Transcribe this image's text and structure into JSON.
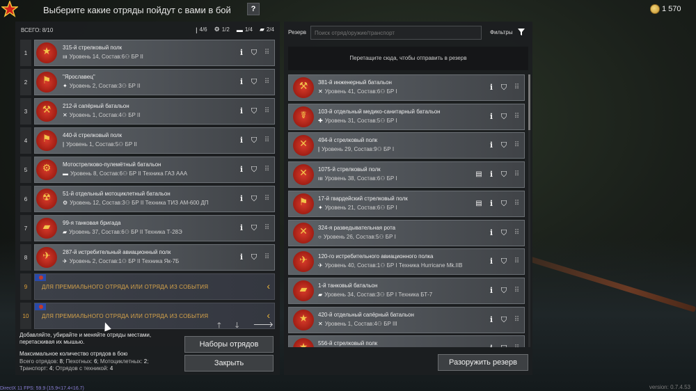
{
  "header": {
    "title": "Выберите какие отряды пойдут с вами в бой",
    "help": "?",
    "gold": "1 570"
  },
  "left": {
    "summary": "ВСЕГО: 8/10",
    "counts": [
      {
        "icon": "infantry-icon",
        "sym": "|",
        "value": "4/6"
      },
      {
        "icon": "motorcycle-icon",
        "sym": "⚙",
        "value": "1/2"
      },
      {
        "icon": "vehicle-icon",
        "sym": "▬",
        "value": "1/4"
      },
      {
        "icon": "tank-icon",
        "sym": "▰",
        "value": "2/4"
      }
    ],
    "squads": [
      {
        "num": "1",
        "name": "315-й стрелковый полк",
        "type": "ııı",
        "info": "Уровень 14, Состав:6⚇ БР II",
        "emblem": "★"
      },
      {
        "num": "2",
        "name": "\"Ярославец\"",
        "type": "✦",
        "info": "Уровень 2, Состав:3⚇ БР II",
        "emblem": "⚑"
      },
      {
        "num": "3",
        "name": "212-й сапёрный батальон",
        "type": "✕",
        "info": "Уровень 1, Состав:4⚇ БР II",
        "emblem": "⚒"
      },
      {
        "num": "4",
        "name": "440-й стрелковый полк",
        "type": "|",
        "info": "Уровень 1, Состав:5⚇ БР II",
        "emblem": "⚑"
      },
      {
        "num": "5",
        "name": "Мотострелково-пулемётный батальон",
        "type": "▬",
        "info": "Уровень 8, Состав:6⚇ БР II  Техника ГАЗ ААА",
        "emblem": "⚙"
      },
      {
        "num": "6",
        "name": "51-й отдельный мотоциклетный батальон",
        "type": "⚙",
        "info": "Уровень 12, Состав:3⚇ БР II  Техника ТИЗ АМ-600 ДП",
        "emblem": "☢"
      },
      {
        "num": "7",
        "name": "99-я танковая бригада",
        "type": "▰",
        "info": "Уровень 37, Состав:6⚇ БР II  Техника Т-28Э",
        "emblem": "▰"
      },
      {
        "num": "8",
        "name": "287-й истребительный авиационный полк",
        "type": "✈",
        "info": "Уровень 2, Состав:1⚇ БР II  Техника Як-7Б",
        "emblem": "✈"
      }
    ],
    "premium": [
      {
        "num": "9",
        "text": "ДЛЯ ПРЕМИАЛЬНОГО ОТРЯДА ИЛИ ОТРЯДА ИЗ СОБЫТИЯ"
      },
      {
        "num": "10",
        "text": "ДЛЯ ПРЕМИАЛЬНОГО ОТРЯДА ИЛИ ОТРЯДА ИЗ СОБЫТИЯ"
      }
    ],
    "hint": "Добавляйте, убирайте и меняйте отряды местами, перетаскивая их мышью.",
    "max_label": "Максимальное количество отрядов в бою",
    "max_line1_a": "Всего отрядов: ",
    "max_total": "8",
    "max_line1_b": "; Пехотных: ",
    "max_inf": "6",
    "max_line1_c": "; Мотоциклетных: ",
    "max_moto": "2",
    "max_line2_a": "Транспорт: ",
    "max_trans": "4",
    "max_line2_b": "; Отрядов с техникой: ",
    "max_tech": "4",
    "presets_label": "Наборы отрядов",
    "close_label": "Закрыть"
  },
  "right": {
    "label": "Резерв",
    "search_placeholder": "Поиск отряд/оружие/транспорт",
    "filters_label": "Фильтры",
    "dropzone": "Перетащите сюда, чтобы отправить в резерв",
    "reserve": [
      {
        "name": "381-й инженерный батальон",
        "type": "✕",
        "info": "Уровень 41, Состав:6⚇ БР I",
        "emblem": "⚒",
        "book": false
      },
      {
        "name": "103-й отдельный медико-санитарный батальон",
        "type": "✚",
        "info": "Уровень 31, Состав:5⚇ БР I",
        "emblem": "☤",
        "book": false
      },
      {
        "name": "494-й стрелковый полк",
        "type": "|",
        "info": "Уровень 29, Состав:9⚇ БР I",
        "emblem": "✕",
        "book": false
      },
      {
        "name": "1075-й стрелковый полк",
        "type": "ııı",
        "info": "Уровень 38, Состав:6⚇ БР I",
        "emblem": "✕",
        "book": true
      },
      {
        "name": "17-й гвардейский стрелковый полк",
        "type": "✦",
        "info": "Уровень 21, Состав:6⚇ БР I",
        "emblem": "⚑",
        "book": true
      },
      {
        "name": "324-я разведывательная рота",
        "type": "○",
        "info": "Уровень 26, Состав:5⚇ БР I",
        "emblem": "✕",
        "book": false
      },
      {
        "name": "120-го истребительного авиационного полка",
        "type": "✈",
        "info": "Уровень 40, Состав:1⚇ БР I  Техника Hurricane Mk.IIB",
        "emblem": "✈",
        "book": false
      },
      {
        "name": "1-й танковый батальон",
        "type": "▰",
        "info": "Уровень 34, Состав:3⚇ БР I  Техника БТ-7",
        "emblem": "▰",
        "book": false
      },
      {
        "name": "420-й отдельный сапёрный батальон",
        "type": "✕",
        "info": "Уровень 1, Состав:4⚇ БР III",
        "emblem": "★",
        "book": false
      },
      {
        "name": "556-й стрелковый полк",
        "type": "|",
        "info": "",
        "emblem": "★",
        "book": false
      }
    ],
    "disarm_label": "Разоружить резерв"
  },
  "footer": {
    "fps": "DirectX 11 FPS: 59.9 (15.9<17.4<16.7)",
    "version": "version: 0.7.4.53"
  }
}
